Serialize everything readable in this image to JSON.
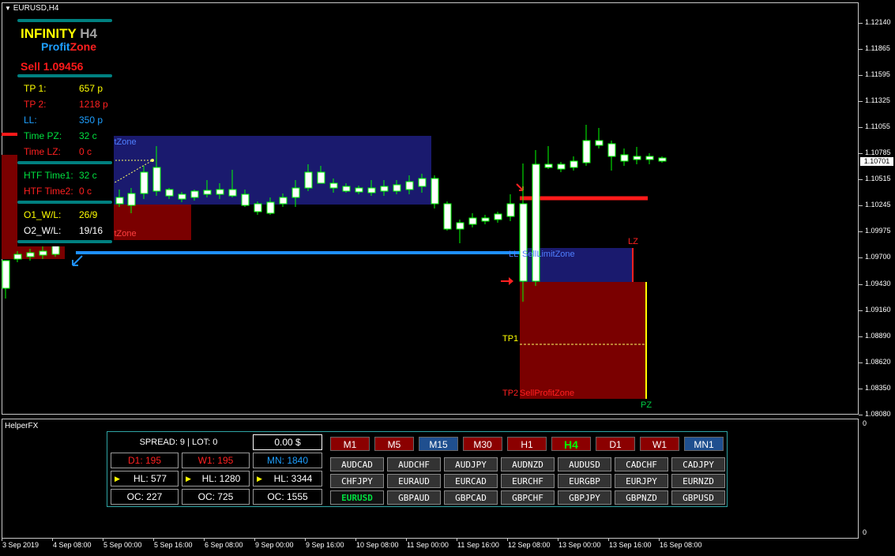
{
  "chart": {
    "title": "EURUSD,H4",
    "current_price": "1.10701",
    "price_labels": [
      "1.12140",
      "1.11865",
      "1.11595",
      "1.11325",
      "1.11055",
      "1.10785",
      "1.10515",
      "1.10245",
      "1.09975",
      "1.09700",
      "1.09430",
      "1.09160",
      "1.08890",
      "1.08620",
      "1.08350",
      "1.08080"
    ],
    "time_labels": [
      "3 Sep 2019",
      "4 Sep 08:00",
      "5 Sep 00:00",
      "5 Sep 16:00",
      "6 Sep 08:00",
      "9 Sep 00:00",
      "9 Sep 16:00",
      "10 Sep 08:00",
      "11 Sep 00:00",
      "11 Sep 16:00",
      "12 Sep 08:00",
      "13 Sep 00:00",
      "13 Sep 16:00",
      "16 Sep 08:00"
    ],
    "zones": {
      "upper_left_zone": "itZone",
      "lower_left_zone": "itZone",
      "sell_limit_zone": "SellLimitZone",
      "ll_label": "LL",
      "lz_label": "LZ",
      "tp1_label": "TP1",
      "tp2_label": "TP2",
      "sell_profit_zone": "SellProfitZone",
      "pz_label": "PZ"
    }
  },
  "subwindow": {
    "title": "HelperFX",
    "scale_top": "0",
    "scale_bottom": "0"
  },
  "panel": {
    "brand_word": "INFINITY",
    "brand_tf": "H4",
    "profit_word": "Profit",
    "zone_word": "Zone",
    "signal": "Sell 1.09456",
    "rows": [
      {
        "label": "TP 1:",
        "value": "657 p"
      },
      {
        "label": "TP 2:",
        "value": "1218 p"
      },
      {
        "label": "LL:",
        "value": "350 p"
      },
      {
        "label": "Time PZ:",
        "value": "32 c"
      },
      {
        "label": "Time LZ:",
        "value": "0 c"
      }
    ],
    "htf_rows": [
      {
        "label": "HTF Time1:",
        "value": "32 c"
      },
      {
        "label": "HTF Time2:",
        "value": "0 c"
      }
    ],
    "wl_rows": [
      {
        "label": "O1_W/L:",
        "value": "26/9"
      },
      {
        "label": "O2_W/L:",
        "value": "19/16"
      }
    ]
  },
  "helper": {
    "spread_lot": "SPREAD: 9  |  LOT: 0",
    "balance": "0.00 $",
    "d1": "D1: 195",
    "w1": "W1: 195",
    "mn": "MN: 1840",
    "hl1": "HL: 577",
    "hl2": "HL: 1280",
    "hl3": "HL: 3344",
    "oc1": "OC: 227",
    "oc2": "OC: 725",
    "oc3": "OC: 1555",
    "play_icon": "▶",
    "timeframes": [
      "M1",
      "M5",
      "M15",
      "M30",
      "H1",
      "H4",
      "D1",
      "W1",
      "MN1"
    ],
    "symbols": [
      [
        "AUDCAD",
        "AUDCHF",
        "AUDJPY",
        "AUDNZD",
        "AUDUSD",
        "CADCHF",
        "CADJPY"
      ],
      [
        "CHFJPY",
        "EURAUD",
        "EURCAD",
        "EURCHF",
        "EURGBP",
        "EURJPY",
        "EURNZD"
      ],
      [
        "EURUSD",
        "GBPAUD",
        "GBPCAD",
        "GBPCHF",
        "GBPJPY",
        "GBPNZD",
        "GBPUSD"
      ]
    ]
  },
  "colors": {
    "bull_candle": "#ffffff",
    "wick": "#00ff00",
    "sell_limit_zone": "#1a1a6e",
    "profit_zone": "#7a0000",
    "stop_line": "#ff1a1a",
    "entry_line": "#1e90ff",
    "tf_red": "#8b0000",
    "tf_blue": "#1f4f8f"
  }
}
